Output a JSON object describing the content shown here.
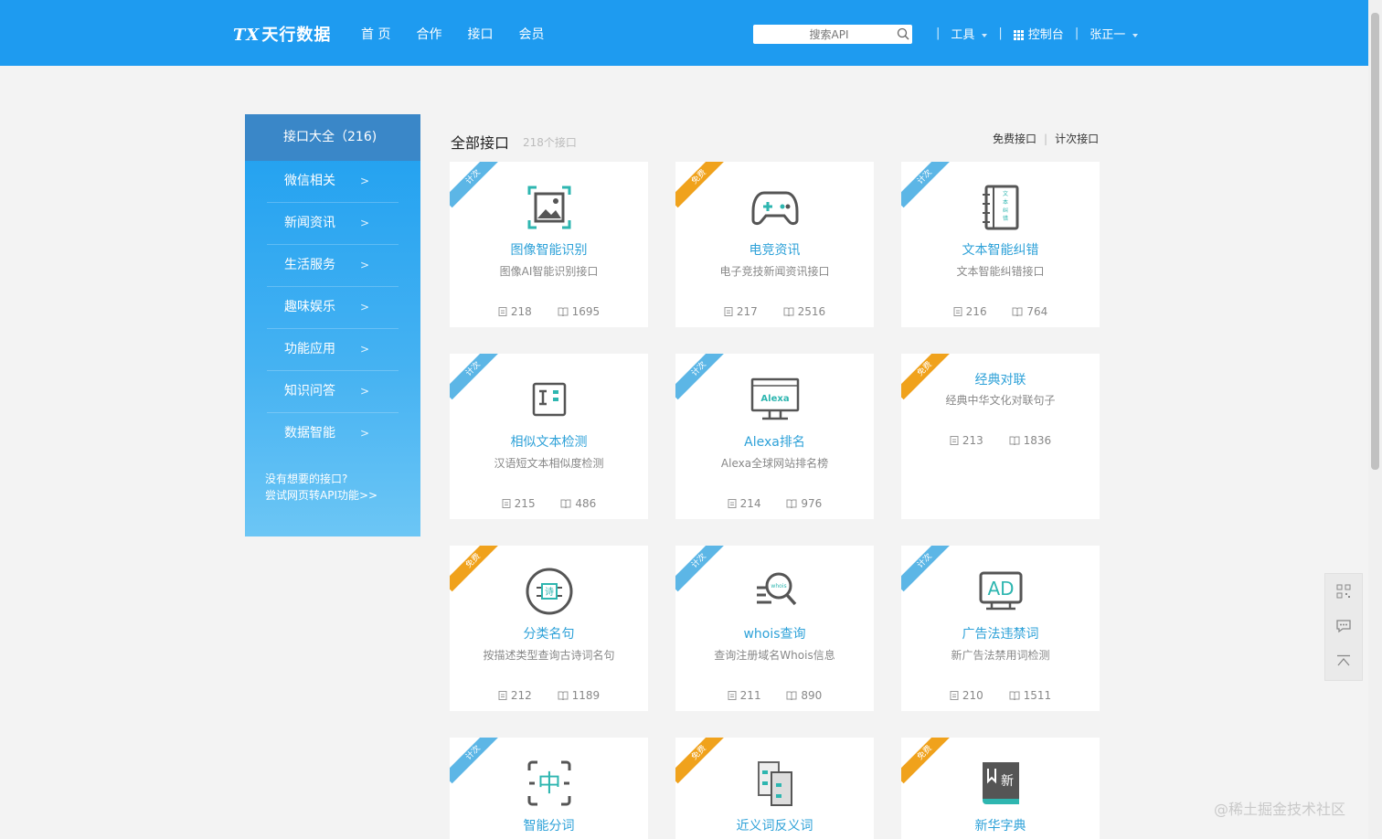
{
  "header": {
    "logo_mark": "TX",
    "logo_text": "天行数据",
    "nav": [
      "首 页",
      "合作",
      "接口",
      "会员"
    ],
    "search_placeholder": "搜索API",
    "tools_label": "工具",
    "console_label": "控制台",
    "user_label": "张正一"
  },
  "sidebar": {
    "title": "接口大全（216)",
    "items": [
      "微信相关",
      "新闻资讯",
      "生活服务",
      "趣味娱乐",
      "功能应用",
      "知识问答",
      "数据智能"
    ],
    "tip_line1": "没有想要的接口?",
    "tip_line2": "尝试网页转API功能>>"
  },
  "main": {
    "title": "全部接口",
    "subtitle": "218个接口",
    "filter_free": "免费接口",
    "filter_count": "计次接口"
  },
  "cards": [
    {
      "ribbon": "计次",
      "ribbon_color": "#5cb6e6",
      "icon": "image-recognition-icon",
      "name": "图像智能识别",
      "desc": "图像AI智能识别接口",
      "id": "218",
      "views": "1695"
    },
    {
      "ribbon": "免费",
      "ribbon_color": "#f0a21c",
      "icon": "gamepad-icon",
      "name": "电竞资讯",
      "desc": "电子竞技新闻资讯接口",
      "id": "217",
      "views": "2516"
    },
    {
      "ribbon": "计次",
      "ribbon_color": "#5cb6e6",
      "icon": "text-book-icon",
      "name": "文本智能纠错",
      "desc": "文本智能纠错接口",
      "id": "216",
      "views": "764"
    },
    {
      "ribbon": "计次",
      "ribbon_color": "#5cb6e6",
      "icon": "text-compare-icon",
      "name": "相似文本检测",
      "desc": "汉语短文本相似度检测",
      "id": "215",
      "views": "486"
    },
    {
      "ribbon": "计次",
      "ribbon_color": "#5cb6e6",
      "icon": "alexa-monitor-icon",
      "name": "Alexa排名",
      "desc": "Alexa全球网站排名榜",
      "id": "214",
      "views": "976"
    },
    {
      "ribbon": "免费",
      "ribbon_color": "#f0a21c",
      "icon": "",
      "name": "经典对联",
      "desc": "经典中华文化对联句子",
      "id": "213",
      "views": "1836"
    },
    {
      "ribbon": "免费",
      "ribbon_color": "#f0a21c",
      "icon": "poem-circle-icon",
      "name": "分类名句",
      "desc": "按描述类型查询古诗词名句",
      "id": "212",
      "views": "1189"
    },
    {
      "ribbon": "计次",
      "ribbon_color": "#5cb6e6",
      "icon": "whois-search-icon",
      "name": "whois查询",
      "desc": "查询注册域名Whois信息",
      "id": "211",
      "views": "890"
    },
    {
      "ribbon": "计次",
      "ribbon_color": "#5cb6e6",
      "icon": "ad-icon",
      "name": "广告法违禁词",
      "desc": "新广告法禁用词检测",
      "id": "210",
      "views": "1511"
    },
    {
      "ribbon": "计次",
      "ribbon_color": "#5cb6e6",
      "icon": "word-split-icon",
      "name": "智能分词",
      "desc": "",
      "id": "",
      "views": ""
    },
    {
      "ribbon": "免费",
      "ribbon_color": "#f0a21c",
      "icon": "synonym-icon",
      "name": "近义词反义词",
      "desc": "",
      "id": "",
      "views": ""
    },
    {
      "ribbon": "免费",
      "ribbon_color": "#f0a21c",
      "icon": "dictionary-icon",
      "name": "新华字典",
      "desc": "",
      "id": "",
      "views": ""
    }
  ],
  "icon_text": {
    "alexa": "Alexa",
    "poem": "诗",
    "whois": "whois",
    "ad": "AD",
    "zhong": "中",
    "xin": "新",
    "text_t": "I",
    "book_chars": "文本纠错"
  },
  "watermark": "@稀土掘金技术社区"
}
